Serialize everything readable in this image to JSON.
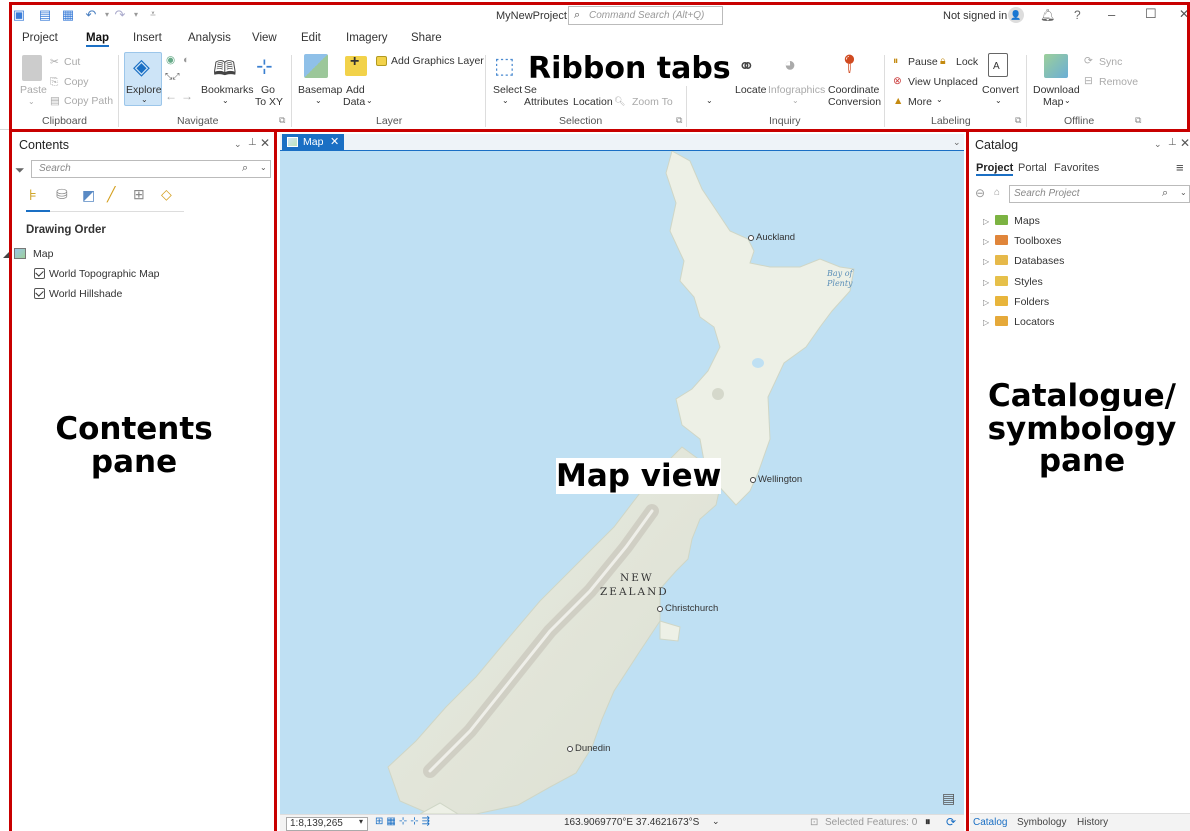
{
  "app": {
    "project_name": "MyNewProject",
    "command_search_placeholder": "Command Search (Alt+Q)",
    "signin": "Not signed in",
    "help": "?",
    "minimize": "–",
    "maximize": "☐",
    "close": "✕"
  },
  "tabs": [
    "Project",
    "Map",
    "Insert",
    "Analysis",
    "View",
    "Edit",
    "Imagery",
    "Share"
  ],
  "ribbon": {
    "clipboard": {
      "paste": "Paste",
      "cut": "Cut",
      "copy": "Copy",
      "copy_path": "Copy Path",
      "label": "Clipboard"
    },
    "navigate": {
      "explore": "Explore",
      "bookmarks": "Bookmarks",
      "go_to_xy_1": "Go",
      "go_to_xy_2": "To XY",
      "label": "Navigate"
    },
    "layer": {
      "basemap": "Basemap",
      "add_data_1": "Add",
      "add_data_2": "Data",
      "add_graphics_layer": "Add Graphics Layer",
      "label": "Layer"
    },
    "selection": {
      "select": "Select",
      "select_by": "Se",
      "attributes": "Attributes",
      "location": "Location",
      "zoom_to": "Zoom To",
      "label": "Selection"
    },
    "inquiry": {
      "locate": "Locate",
      "infographics": "Infographics",
      "coordinate_1": "Coordinate",
      "coordinate_2": "Conversion",
      "label": "Inquiry"
    },
    "labeling": {
      "pause": "Pause",
      "lock": "Lock",
      "view_unplaced": "View Unplaced",
      "more": "More",
      "convert": "Convert",
      "label": "Labeling"
    },
    "offline": {
      "download_1": "Download",
      "download_2": "Map",
      "sync": "Sync",
      "remove": "Remove",
      "label": "Offline"
    }
  },
  "contents": {
    "title": "Contents",
    "search_placeholder": "Search",
    "drawing_order": "Drawing Order",
    "map_item": "Map",
    "layers": [
      "World Topographic Map",
      "World Hillshade"
    ]
  },
  "map_view": {
    "tab": "Map",
    "scale": "1:8,139,265",
    "coordinates": "163.9069770°E 37.4621673°S",
    "selected_features": "Selected Features: 0",
    "labels": {
      "auckland": "Auckland",
      "bay_of_plenty_1": "Bay of",
      "bay_of_plenty_2": "Plenty",
      "wellington": "Wellington",
      "new": "NEW",
      "zealand": "ZEALAND",
      "christchurch": "Christchurch",
      "dunedin": "Dunedin"
    }
  },
  "catalog": {
    "title": "Catalog",
    "tabs": [
      "Project",
      "Portal",
      "Favorites"
    ],
    "search_placeholder": "Search Project",
    "items": [
      "Maps",
      "Toolboxes",
      "Databases",
      "Styles",
      "Folders",
      "Locators"
    ],
    "bottom_tabs": [
      "Catalog",
      "Symbology",
      "History"
    ]
  },
  "annotations": {
    "ribbon": "Ribbon tabs",
    "contents_1": "Contents",
    "contents_2": "pane",
    "map": "Map view",
    "catalog_1": "Catalogue/",
    "catalog_2": "symbology",
    "catalog_3": "pane"
  },
  "colors": {
    "accent": "#1a6fc4",
    "annotation_border": "#c80000",
    "water": "#bfe0f3",
    "land": "#ecefe6"
  }
}
